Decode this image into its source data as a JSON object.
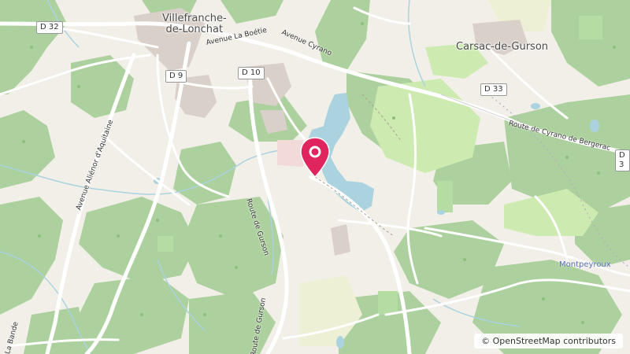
{
  "map": {
    "towns": {
      "villefranche_line1": "Villefranche-",
      "villefranche_line2": "de-Lonchat",
      "carsac": "Carsac-de-Gurson",
      "montpeyroux": "Montpeyroux"
    },
    "roads": {
      "d32": "D 32",
      "d9": "D 9",
      "d10": "D 10",
      "d33": "D 33",
      "d3_partial": "D 3",
      "avenue_la_boetie": "Avenue La Boétie",
      "avenue_cyrano": "Avenue Cyrano",
      "route_cyrano": "Route de Cyrano de Bergerac",
      "avenue_alienor": "Avenue Aliénor d'Aquitaine",
      "route_gurson": "Route de Gurson",
      "route_gurson_south": "Route de Gurson",
      "la_bande": "La Bande"
    },
    "attribution": "© OpenStreetMap contributors",
    "marker": {
      "color": "#e0245e",
      "icon": "map-pin-icon"
    }
  }
}
